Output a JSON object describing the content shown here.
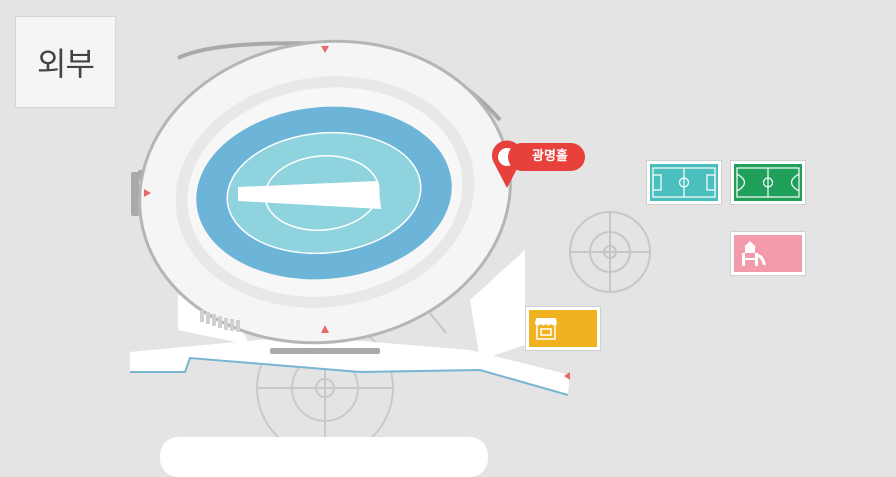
{
  "view_label": "외부",
  "pin": {
    "label": "광명홀",
    "color": "#e8403a"
  },
  "pois": [
    {
      "name": "soccer-field",
      "color": "#4bbfbd",
      "icon": "soccer-field-icon"
    },
    {
      "name": "soccer-field",
      "color": "#1fa15c",
      "icon": "soccer-field-icon"
    },
    {
      "name": "playground",
      "color": "#f49bab",
      "icon": "playground-icon"
    },
    {
      "name": "store",
      "color": "#f0b21e",
      "icon": "store-icon"
    }
  ],
  "colors": {
    "background": "#e4e4e4",
    "stadium_shell": "#f4f4f4",
    "track": "#6db5d8",
    "field": "#8fd3de",
    "marker": "#e86b6b"
  }
}
